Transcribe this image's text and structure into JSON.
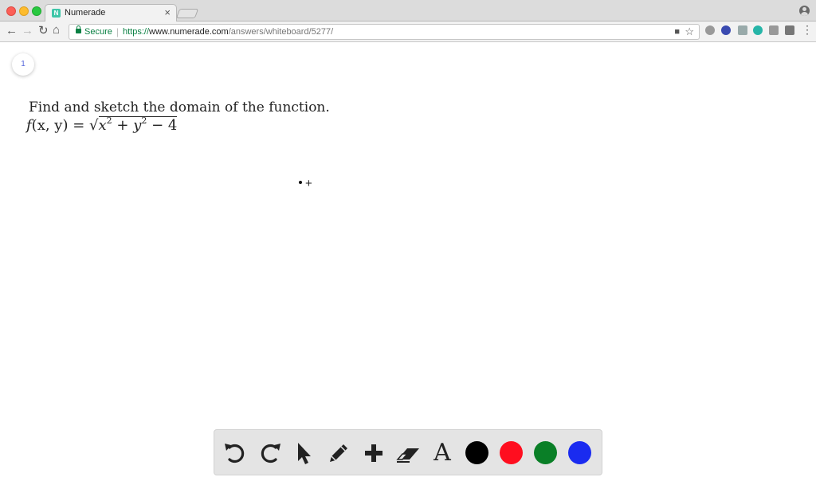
{
  "browser": {
    "tab": {
      "title": "Numerade",
      "favicon_letter": "N",
      "close_glyph": "×"
    },
    "toolbar": {
      "secure_label": "Secure",
      "url_scheme": "https://",
      "url_host": "www.numerade.com",
      "url_path": "/answers/whiteboard/5277/"
    }
  },
  "page": {
    "badge_number": "1",
    "question": "Find and sketch the domain of the function.",
    "formula": {
      "lhs_f": "f",
      "lhs_args": "(x, y) =",
      "radical_sign": "√",
      "x": "x",
      "exp1": "2",
      "plus": " + ",
      "y": "y",
      "exp2": "2",
      "minus_const": " − 4"
    }
  },
  "drawing_toolbar": {
    "tools": [
      "undo-icon",
      "redo-icon",
      "pointer-icon",
      "pencil-icon",
      "plus-icon",
      "eraser-icon",
      "text-icon"
    ],
    "text_tool_label": "A",
    "colors": {
      "black": "#000000",
      "red": "#ff0e1f",
      "green": "#0a7f27",
      "blue": "#1a2bf0"
    }
  }
}
